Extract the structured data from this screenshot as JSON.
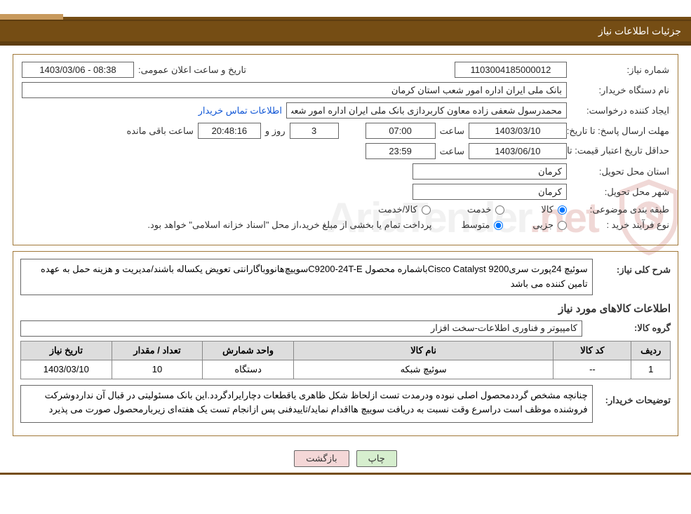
{
  "header": {
    "title": "جزئیات اطلاعات نیاز"
  },
  "fields": {
    "need_number_label": "شماره نیاز:",
    "need_number": "1103004185000012",
    "announce_label": "تاریخ و ساعت اعلان عمومی:",
    "announce_value": "1403/03/06 - 08:38",
    "buyer_org_label": "نام دستگاه خریدار:",
    "buyer_org": "بانک ملی ایران اداره امور شعب استان کرمان",
    "requester_label": "ایجاد کننده درخواست:",
    "requester": "محمدرسول شعفی زاده معاون کاربردازی بانک ملی ایران اداره امور شعب استان",
    "contact_link": "اطلاعات تماس خریدار",
    "reply_deadline_label": "مهلت ارسال پاسخ: تا تاریخ:",
    "reply_date": "1403/03/10",
    "time_label": "ساعت",
    "reply_time": "07:00",
    "days_remaining": "3",
    "days_and_label": "روز و",
    "time_remaining": "20:48:16",
    "time_remaining_label": "ساعت باقی مانده",
    "price_valid_label": "حداقل تاریخ اعتبار قیمت: تا تاریخ:",
    "price_valid_date": "1403/06/10",
    "price_valid_time": "23:59",
    "province_label": "استان محل تحویل:",
    "province": "کرمان",
    "city_label": "شهر محل تحویل:",
    "city": "کرمان",
    "cat_label": "طبقه بندی موضوعی:",
    "cat_goods": "کالا",
    "cat_service": "خدمت",
    "cat_goods_service": "کالا/خدمت",
    "purchase_type_label": "نوع فرآیند خرید :",
    "purchase_partial": "جزیی",
    "purchase_medium": "متوسط",
    "purchase_note": "پرداخت تمام یا بخشی از مبلغ خرید،از محل \"اسناد خزانه اسلامی\" خواهد بود."
  },
  "desc": {
    "general_label": "شرح کلی نیاز:",
    "general_text": "سوئیچ 24پورت سریCisco Catalyst 9200باشماره محصول C9200-24T-Eسوییچ‌هانووباگارانتی تعویض یکساله باشند/مدیریت و هزینه حمل به عهده تامین کننده می باشد",
    "items_head": "اطلاعات کالاهای مورد نیاز",
    "group_label": "گروه کالا:",
    "group": "کامپیوتر و فناوری اطلاعات-سخت افزار"
  },
  "table": {
    "headers": [
      "ردیف",
      "کد کالا",
      "نام کالا",
      "واحد شمارش",
      "تعداد / مقدار",
      "تاریخ نیاز"
    ],
    "cells": [
      "1",
      "--",
      "سوئیچ شبکه",
      "دستگاه",
      "10",
      "1403/03/10"
    ]
  },
  "buyer_notes": {
    "label": "توضیحات خریدار:",
    "text": "چنانچه مشخص گرددمحصول اصلی نبوده ودرمدت تست ازلحاظ شکل ظاهری یاقطعات دچارایرادگردد.این بانک مسئولیتی در قبال آن نداردوشرکت فروشنده موظف است دراسرع وقت نسبت به دریافت سوییچ هااقدام نماید/تاییدفنی پس ازانجام تست یک هفته‌ای زیربارمحصول صورت می پذیرد"
  },
  "buttons": {
    "print": "چاپ",
    "back": "بازگشت"
  },
  "watermark": {
    "text_a": "AriaTender",
    "text_b": ".n",
    "text_c": "et"
  }
}
